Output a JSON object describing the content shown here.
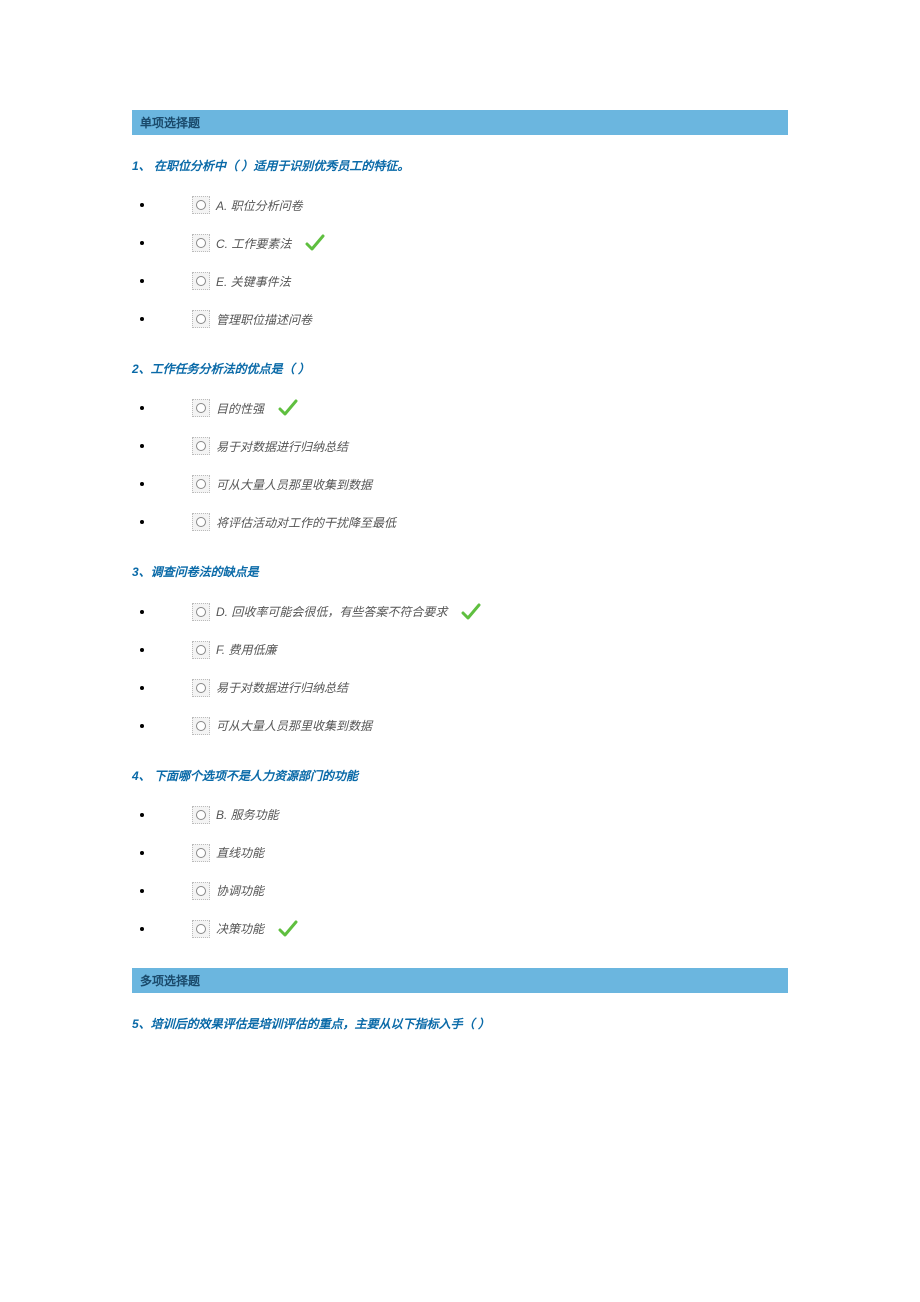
{
  "sections": {
    "single": "单项选择题",
    "multi": "多项选择题"
  },
  "q1": {
    "title": "1、 在职位分析中（ ）适用于识别优秀员工的特征。",
    "opts": {
      "a": "A. 职位分析问卷",
      "b": "C. 工作要素法",
      "c": "E. 关键事件法",
      "d": "管理职位描述问卷"
    }
  },
  "q2": {
    "title": "2、工作任务分析法的优点是（ ）",
    "opts": {
      "a": "目的性强",
      "b": "易于对数据进行归纳总结",
      "c": "可从大量人员那里收集到数据",
      "d": "将评估活动对工作的干扰降至最低"
    }
  },
  "q3": {
    "title": "3、调查问卷法的缺点是",
    "opts": {
      "a": "D. 回收率可能会很低，有些答案不符合要求",
      "b": "F. 费用低廉",
      "c": "易于对数据进行归纳总结",
      "d": "可从大量人员那里收集到数据"
    }
  },
  "q4": {
    "title": "4、 下面哪个选项不是人力资源部门的功能",
    "opts": {
      "a": "B. 服务功能",
      "b": "直线功能",
      "c": "协调功能",
      "d": "决策功能"
    }
  },
  "q5": {
    "title": "5、培训后的效果评估是培训评估的重点，主要从以下指标入手（ ）"
  }
}
